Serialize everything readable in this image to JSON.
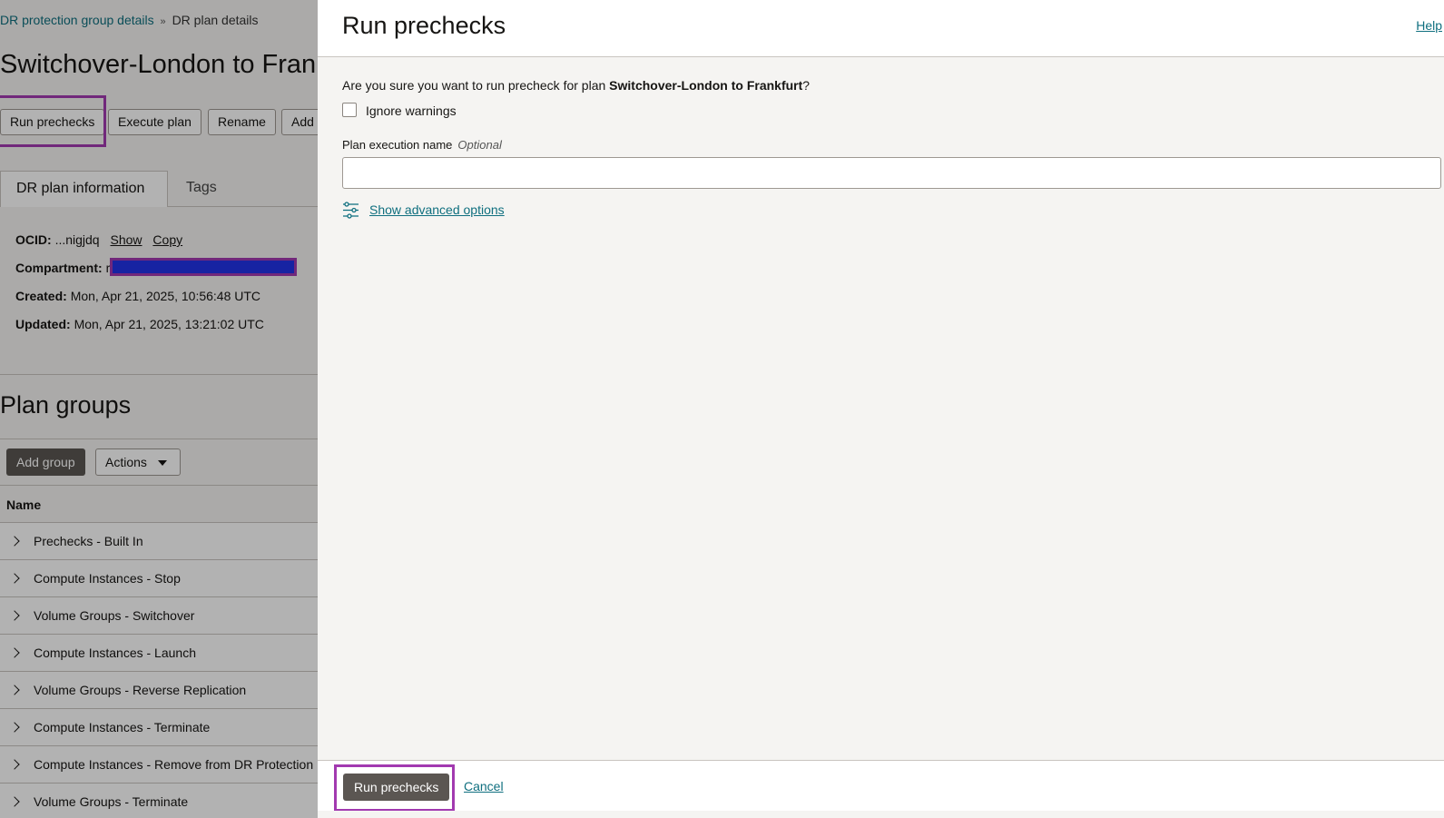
{
  "background": {
    "breadcrumb": {
      "parent": "DR protection group details",
      "separator": "»",
      "current": "DR plan details"
    },
    "plan_title": "Switchover-London to Frankfurt",
    "buttons": {
      "run_prechecks": "Run prechecks",
      "execute_plan": "Execute plan",
      "rename": "Rename",
      "add": "Add"
    },
    "tabs": {
      "active": "DR plan information",
      "other": "Tags"
    },
    "info": {
      "ocid_label": "OCID:",
      "ocid_value": "...nigjdq",
      "show": "Show",
      "copy": "Copy",
      "compartment_label": "Compartment:",
      "compartment_value": "r",
      "created_label": "Created:",
      "created_value": "Mon, Apr 21, 2025, 10:56:48 UTC",
      "updated_label": "Updated:",
      "updated_value": "Mon, Apr 21, 2025, 13:21:02 UTC"
    },
    "plan_groups": {
      "title": "Plan groups",
      "add_group": "Add group",
      "actions": "Actions",
      "column_name": "Name",
      "rows": [
        "Prechecks - Built In",
        "Compute Instances - Stop",
        "Volume Groups - Switchover",
        "Compute Instances - Launch",
        "Volume Groups - Reverse Replication",
        "Compute Instances - Terminate",
        "Compute Instances - Remove from DR Protection",
        "Volume Groups - Terminate"
      ]
    }
  },
  "drawer": {
    "title": "Run prechecks",
    "help": "Help",
    "confirm_prefix": "Are you sure you want to run precheck for plan ",
    "confirm_plan": "Switchover-London to Frankfurt",
    "confirm_suffix": "?",
    "ignore_warnings": "Ignore warnings",
    "exec_name_label": "Plan execution name",
    "exec_name_optional": "Optional",
    "exec_name_value": "",
    "advanced_options": "Show advanced options",
    "submit": "Run prechecks",
    "cancel": "Cancel"
  },
  "colors": {
    "highlight": "#a23ab0",
    "link": "#0f6f7f",
    "primary_button": "#5b5652",
    "redaction": "#2233e8"
  }
}
